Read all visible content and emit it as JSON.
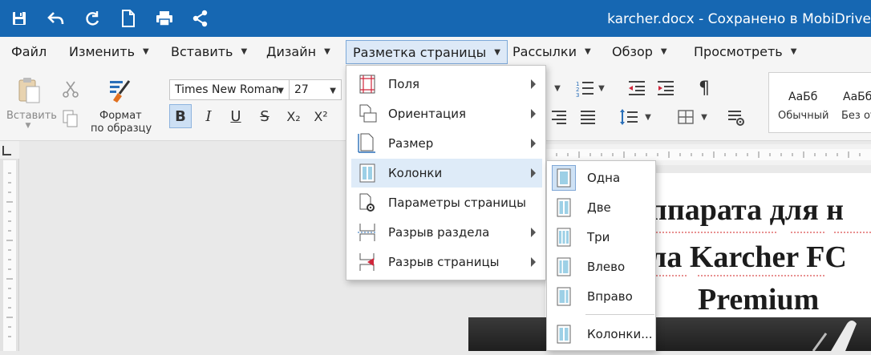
{
  "titlebar": {
    "document_title": "karcher.docx - Сохранено в MobiDrive",
    "icons": [
      "save-icon",
      "undo-icon",
      "redo-icon",
      "new-document-icon",
      "print-icon",
      "share-icon"
    ]
  },
  "menubar": {
    "items": [
      {
        "label": "Файл"
      },
      {
        "label": "Изменить"
      },
      {
        "label": "Вставить"
      },
      {
        "label": "Дизайн"
      },
      {
        "label": "Разметка страницы"
      },
      {
        "label": "Рассылки"
      },
      {
        "label": "Обзор"
      },
      {
        "label": "Просмотреть"
      }
    ]
  },
  "ribbon": {
    "paste_label": "Вставить",
    "format_painter_label_1": "Формат",
    "format_painter_label_2": "по образцу",
    "font_name": "Times New Roman",
    "font_size": "27",
    "bold": "B",
    "italic": "I",
    "underline": "U",
    "strike": "S",
    "subscript": "X₂",
    "superscript": "X²",
    "pilcrow": "¶",
    "style_normal_sample": "АаБб",
    "style_normal_name": "Обычный",
    "style_second_sample": "АаБб",
    "style_second_name": "Без от"
  },
  "page_layout_menu": {
    "items": [
      {
        "label": "Поля",
        "icon": "margins-icon",
        "submenu": true
      },
      {
        "label": "Ориентация",
        "icon": "orientation-icon",
        "submenu": true
      },
      {
        "label": "Размер",
        "icon": "page-size-icon",
        "submenu": true
      },
      {
        "label": "Колонки",
        "icon": "columns-icon",
        "submenu": true
      },
      {
        "label": "Параметры страницы",
        "icon": "page-setup-icon",
        "submenu": false
      },
      {
        "label": "Разрыв раздела",
        "icon": "section-break-icon",
        "submenu": true
      },
      {
        "label": "Разрыв страницы",
        "icon": "page-break-icon",
        "submenu": true
      }
    ],
    "highlighted": "Колонки"
  },
  "columns_submenu": {
    "items": [
      {
        "label": "Одна"
      },
      {
        "label": "Две"
      },
      {
        "label": "Три"
      },
      {
        "label": "Влево"
      },
      {
        "label": "Вправо"
      },
      {
        "label": "Колонки..."
      }
    ],
    "selected": "Одна"
  },
  "document": {
    "line1": "ппарата для",
    "line1_tail": "н",
    "line2": "ла Karcher FC",
    "line3": "Premium"
  },
  "colors": {
    "titlebar": "#1667b2",
    "menu_highlight": "#deebf8",
    "column_icon": "#9dd0e6"
  }
}
